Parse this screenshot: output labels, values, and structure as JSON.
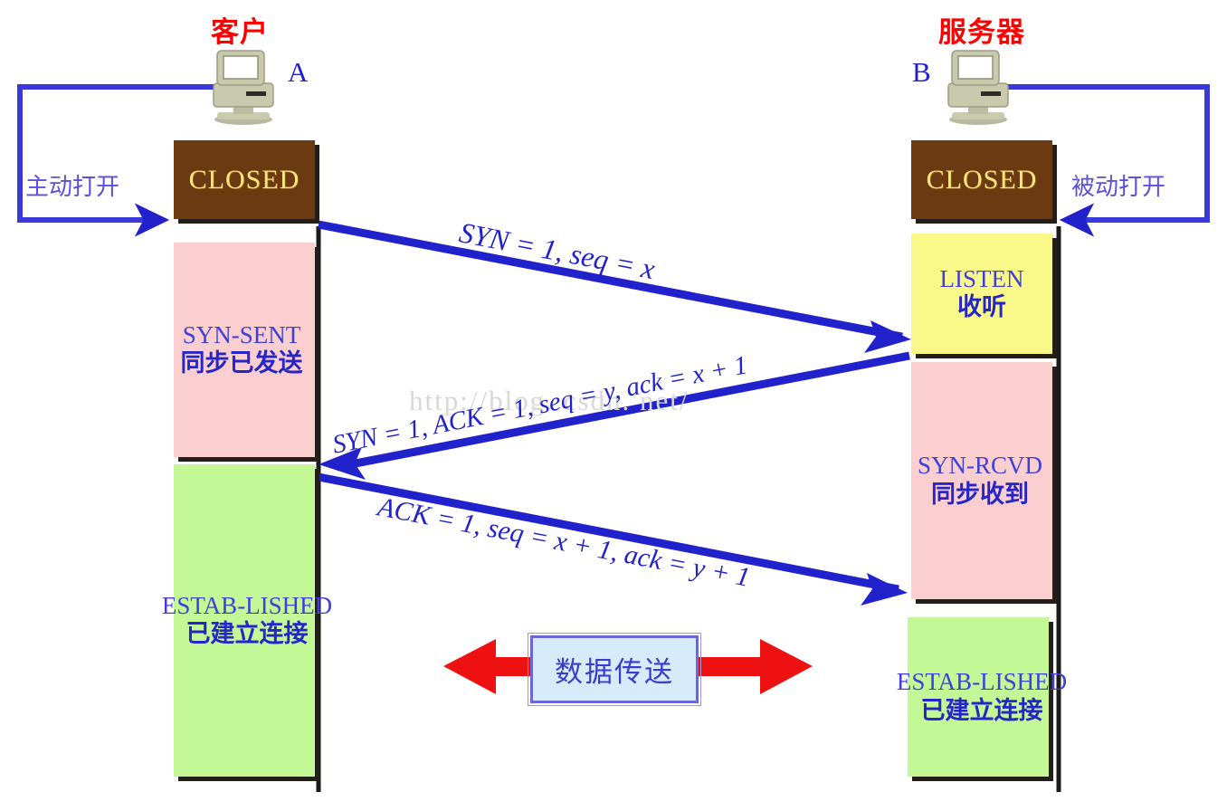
{
  "diagram": {
    "title_client": "客户",
    "title_server": "服务器",
    "client_letter": "A",
    "server_letter": "B",
    "active_open_label": "主动打开",
    "passive_open_label": "被动打开",
    "watermark": "http://blog. csdn. net/",
    "colors": {
      "closed_bg": "#6b3a10",
      "closed_text": "#ffe680",
      "pink_bg": "#fbcfd0",
      "yellow_bg": "#fbf88a",
      "green_bg": "#c4f795",
      "state_text": "#4040d8",
      "arrow_blue": "#2222cc",
      "arrow_red": "#ee1111",
      "title_red": "#ff0000",
      "data_box_bg": "#d6ecfb",
      "data_box_border": "#6a68d8",
      "shadow": "#231f18"
    }
  },
  "client_states": [
    {
      "en": "CLOSED",
      "cn": ""
    },
    {
      "en": "SYN-SENT",
      "cn": "同步已发送"
    },
    {
      "en": "ESTAB-LISHED",
      "cn": "已建立连接"
    }
  ],
  "server_states": [
    {
      "en": "CLOSED",
      "cn": ""
    },
    {
      "en": "LISTEN",
      "cn": "收听"
    },
    {
      "en": "SYN-RCVD",
      "cn": "同步收到"
    },
    {
      "en": "ESTAB-LISHED",
      "cn": "已建立连接"
    }
  ],
  "messages": [
    {
      "id": "syn",
      "text": "SYN = 1, seq = x",
      "direction": "client-to-server"
    },
    {
      "id": "synack",
      "text": "SYN = 1, ACK = 1, seq = y, ack = x + 1",
      "direction": "server-to-client"
    },
    {
      "id": "ack",
      "text": "ACK = 1, seq = x + 1, ack = y + 1",
      "direction": "client-to-server"
    }
  ],
  "data_transfer": {
    "label": "数据传送"
  }
}
